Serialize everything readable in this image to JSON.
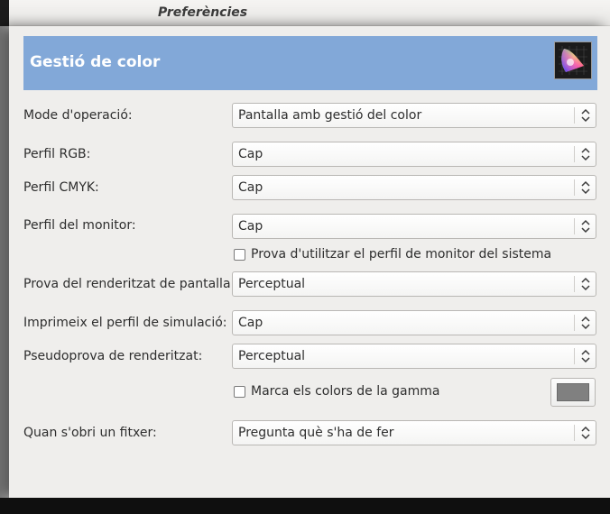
{
  "window": {
    "title": "Preferències"
  },
  "header": {
    "title": "Gestió de color",
    "icon": "color-gamut-icon"
  },
  "rows": {
    "mode": {
      "label": "Mode d'operació:",
      "value": "Pantalla amb gestió del color"
    },
    "rgb": {
      "label": "Perfil RGB:",
      "value": "Cap"
    },
    "cmyk": {
      "label": "Perfil CMYK:",
      "value": "Cap"
    },
    "monitor": {
      "label": "Perfil del monitor:",
      "value": "Cap"
    },
    "system_monitor_check": {
      "label": "Prova d'utilitzar el perfil de monitor del sistema",
      "checked": false
    },
    "display_rendering": {
      "label": "Prova del renderitzat de pantalla:",
      "value": "Perceptual"
    },
    "print_simulation": {
      "label": "Imprimeix el perfil de simulació:",
      "value": "Cap"
    },
    "softproof_rendering": {
      "label": "Pseudoprova de renderitzat:",
      "value": "Perceptual"
    },
    "mark_gamut_check": {
      "label": "Marca els colors de la gamma",
      "checked": false
    },
    "on_open": {
      "label": "Quan s'obri un fitxer:",
      "value": "Pregunta què s'ha de fer"
    }
  },
  "colors": {
    "header_bg": "#82a8d8",
    "gamut_warning_color": "#808080"
  }
}
